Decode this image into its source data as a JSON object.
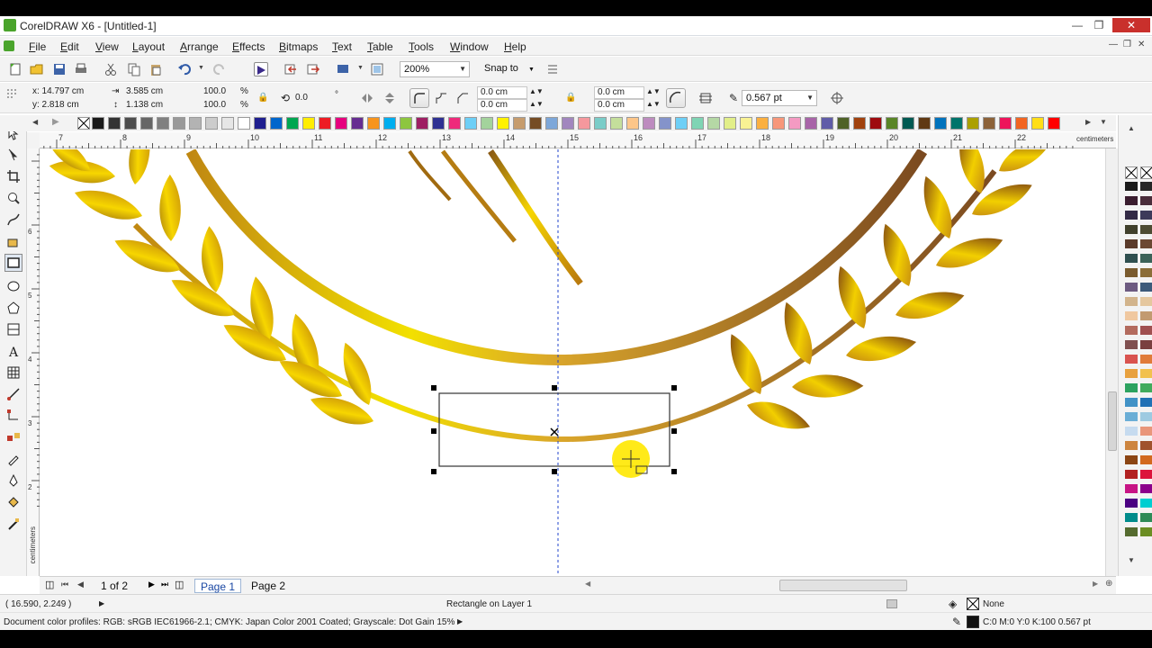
{
  "window": {
    "title": "CorelDRAW X6 - [Untitled-1]"
  },
  "menu": {
    "items": [
      "File",
      "Edit",
      "View",
      "Layout",
      "Arrange",
      "Effects",
      "Bitmaps",
      "Text",
      "Table",
      "Tools",
      "Window",
      "Help"
    ]
  },
  "toolbar": {
    "zoom": "200%",
    "snap_to": "Snap to"
  },
  "property_bar": {
    "x": "x: 14.797 cm",
    "y": "y: 2.818 cm",
    "width": "3.585 cm",
    "height": "1.138 cm",
    "scale_x": "100.0",
    "scale_y": "100.0",
    "pct1": "%",
    "pct2": "%",
    "rotation": "0.0",
    "corner1": "0.0 cm",
    "corner2": "0.0 cm",
    "corner3": "0.0 cm",
    "corner4": "0.0 cm",
    "outline_width": "0.567 pt"
  },
  "ruler": {
    "unit": "centimeters",
    "h_ticks": [
      "7",
      "8",
      "9",
      "10",
      "11",
      "12",
      "13",
      "14",
      "15",
      "16",
      "17",
      "18",
      "19",
      "20",
      "21",
      "22"
    ],
    "v_ticks": [
      "6",
      "5",
      "4",
      "3",
      "2"
    ],
    "v_unit": "centimeters"
  },
  "pages": {
    "counter": "1 of 2",
    "tabs": [
      "Page 1",
      "Page 2"
    ]
  },
  "status": {
    "coords": "( 16.590, 2.249 )",
    "selection": "Rectangle on Layer 1",
    "fill": "None",
    "outline": "C:0 M:0 Y:0 K:100  0.567 pt",
    "profiles": "Document color profiles: RGB: sRGB IEC61966-2.1; CMYK: Japan Color 2001 Coated; Grayscale: Dot Gain 15%"
  },
  "palette_colors": [
    "#1a1a1a",
    "#333333",
    "#4d4d4d",
    "#666666",
    "#808080",
    "#999999",
    "#b3b3b3",
    "#cccccc",
    "#e6e6e6",
    "#ffffff",
    "#1f1f8f",
    "#0066cc",
    "#00a651",
    "#ffed00",
    "#ed1c24",
    "#e6007e",
    "#662d91",
    "#f7941d",
    "#00aeef",
    "#8dc63f",
    "#9e1f63",
    "#2e3192",
    "#ee2a7b",
    "#6dcff6",
    "#a3d39c",
    "#fff200",
    "#c69c6d",
    "#754c24",
    "#7da7d9",
    "#a186be",
    "#f5989d",
    "#7accc8",
    "#c4df9b",
    "#fdc689",
    "#bd8cbf",
    "#8493ca",
    "#6ecff6",
    "#7fd4b4",
    "#b5d8a5",
    "#e2ef89",
    "#f9f293",
    "#fbb040",
    "#f7977a",
    "#f49ac2",
    "#a864a8",
    "#605ca8",
    "#4f6228",
    "#a0410d",
    "#9e0b0f",
    "#598527",
    "#005952",
    "#603913",
    "#0072bc",
    "#00746b",
    "#aba000",
    "#8c6239",
    "#ed145b",
    "#f26522",
    "#ffde17",
    "#ff0000"
  ],
  "right_palette_colors": [
    "#1a1a1a",
    "#262626",
    "#3a1d2f",
    "#4a2d3b",
    "#332a46",
    "#3d3a5a",
    "#40402c",
    "#4e4c33",
    "#5b3b2b",
    "#6b4832",
    "#2f4f4f",
    "#3b6258",
    "#7a5b2e",
    "#8b6d38",
    "#6d5b81",
    "#3c5a7a",
    "#d2b48c",
    "#e5c79e",
    "#f0c8a0",
    "#c29a70",
    "#b36b5e",
    "#a05050",
    "#805050",
    "#7a3f3f",
    "#d9534f",
    "#e07b39",
    "#e8a13f",
    "#f2c14e",
    "#2ca25f",
    "#41ab5d",
    "#4292c6",
    "#2171b5",
    "#6baed6",
    "#9ecae1",
    "#c6dbef",
    "#e9967a",
    "#cd853f",
    "#a0522d",
    "#8b4513",
    "#d2691e",
    "#b22222",
    "#dc143c",
    "#c71585",
    "#8b008b",
    "#4b0082",
    "#00ced1",
    "#008b8b",
    "#2e8b57",
    "#556b2f",
    "#6b8e23"
  ]
}
